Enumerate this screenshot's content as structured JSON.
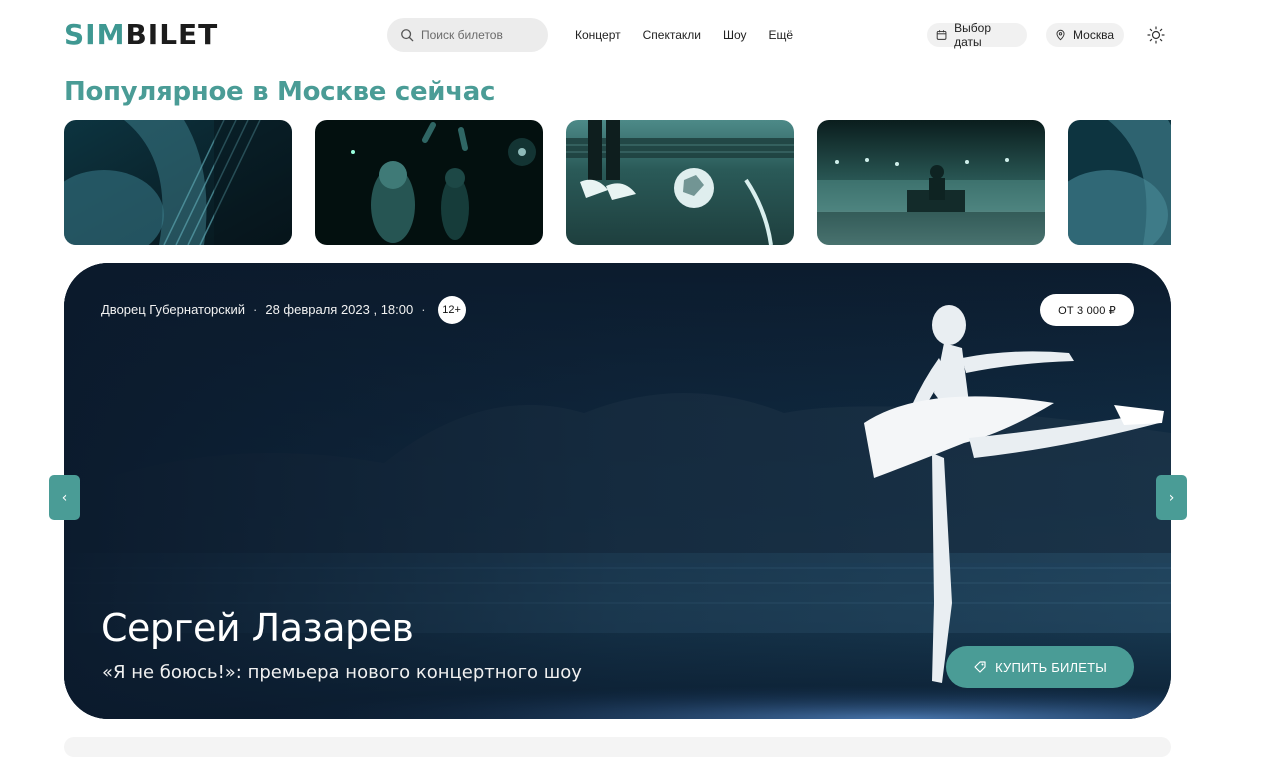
{
  "header": {
    "logo": {
      "part1": "SIM",
      "part2": "BILET"
    },
    "search_placeholder": "Поиск билетов",
    "nav": [
      "Концерт",
      "Спектакли",
      "Шоу",
      "Ещё"
    ],
    "date_pill": "Выбор даты",
    "city_pill": "Москва"
  },
  "section_title": "Популярное в Москве сейчас",
  "thumbnails": [
    {
      "subject": "guitar-player"
    },
    {
      "subject": "concert-crowd"
    },
    {
      "subject": "football-pitch"
    },
    {
      "subject": "dj-stage"
    },
    {
      "subject": "guitar-player"
    }
  ],
  "hero": {
    "venue": "Дворец Губернаторский",
    "datetime": "28 февраля 2023 , 18:00",
    "age": "12+",
    "price": "ОТ 3 000 ₽",
    "title": "Сергей Лазарев",
    "subtitle": "«Я не боюсь!»: премьера нового концертного шоу",
    "buy_label": "КУПИТЬ БИЛЕТЫ"
  },
  "carousel": {
    "prev": "‹",
    "next": "›"
  },
  "colors": {
    "accent": "#4a9c96",
    "dark": "#0b1a2c"
  }
}
